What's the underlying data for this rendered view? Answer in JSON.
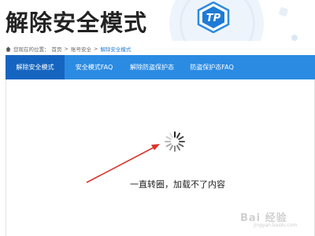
{
  "header": {
    "title": "解除安全模式",
    "logo_text": "TP"
  },
  "breadcrumb": {
    "prefix": "您现在的位置：",
    "items": [
      "首页",
      "账号安全",
      "解除安全模式"
    ],
    "separator": ">"
  },
  "tabs": [
    {
      "label": "解除安全模式",
      "active": true
    },
    {
      "label": "安全模式FAQ",
      "active": false
    },
    {
      "label": "解除防盗保护态",
      "active": false
    },
    {
      "label": "防盗保护态FAQ",
      "active": false
    }
  ],
  "content": {
    "loading_note": "一直转圈，加载不了内容"
  },
  "watermark": {
    "text": "Bai 经验",
    "sub": "jingyan.baidu.com"
  },
  "colors": {
    "tab_bar": "#2b8be3",
    "tab_active": "#1565c0",
    "arrow": "#d9342b",
    "link": "#1e7bd6"
  }
}
